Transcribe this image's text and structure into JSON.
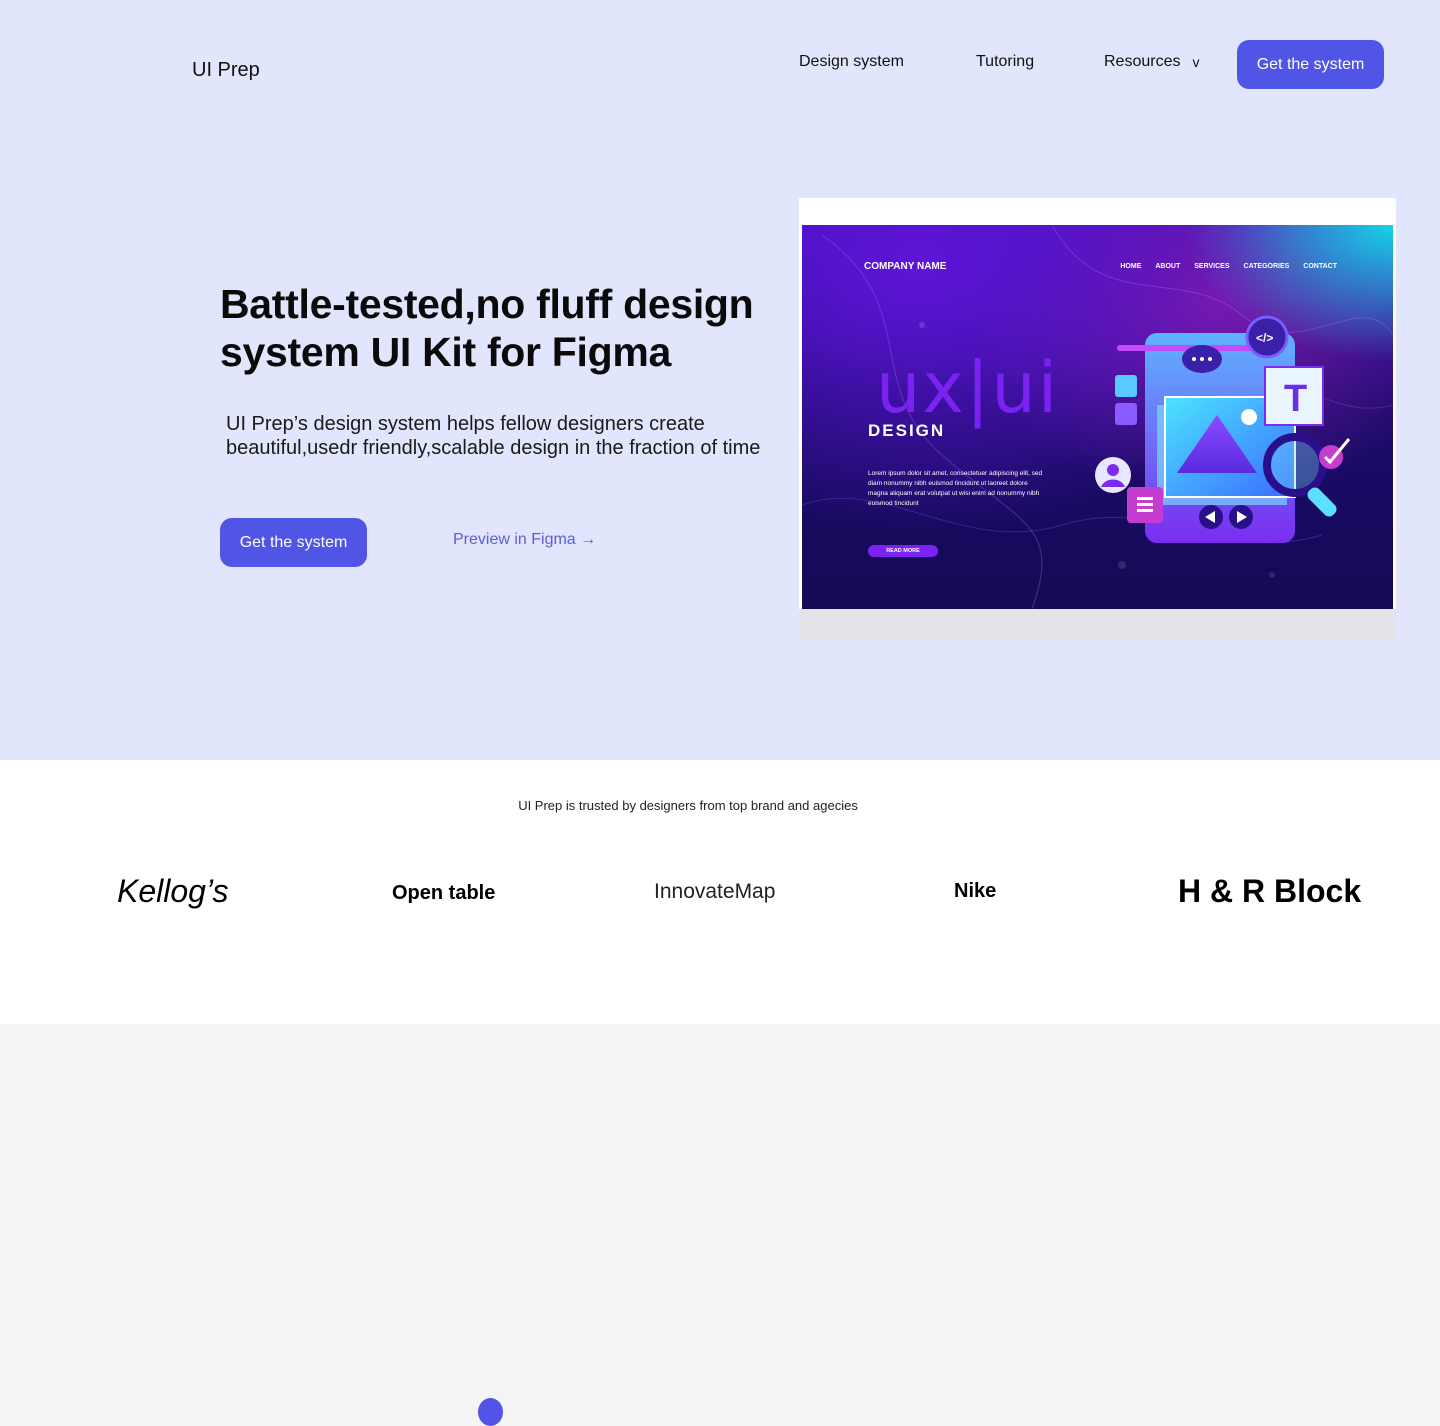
{
  "header": {
    "logo": "UI Prep",
    "nav": {
      "design_system": "Design system",
      "tutoring": "Tutoring",
      "resources": "Resources",
      "resources_chevron": "v"
    },
    "cta": "Get the system"
  },
  "hero": {
    "headline": "Battle-tested,no fluff design system UI Kit for Figma",
    "subtext": "UI  Prep’s design system helps fellow designers create beautiful,usedr friendly,scalable design in the fraction of time",
    "primary_cta": "Get the system",
    "secondary_cta": "Preview in Figma →"
  },
  "mockup": {
    "company": "COMPANY NAME",
    "nav": [
      "HOME",
      "ABOUT",
      "SERVICES",
      "CATEGORIES",
      "CONTACT"
    ],
    "big_text": "ux|ui",
    "design_label": "DESIGN",
    "body": "Lorem ipsum dolor sit amet, consectetuer adipiscing elit, sed diam nonummy nibh euismod tincidunt ut laoreet dolore magna aliquam erat volutpat ut wisi enim ad nonummy nibh euismod tincidunt",
    "read_more": "READ MORE",
    "tile_letter": "T",
    "code_glyph": "</>"
  },
  "brands": {
    "trusted_text": "UI Prep is trusted by designers from top brand and agecies",
    "logos": [
      "Kellog’s",
      "Open table",
      "InnovateMap",
      "Nike",
      "H & R Block"
    ]
  },
  "colors": {
    "hero_bg": "#e1e6fc",
    "accent": "#5055e6",
    "link": "#5b5fd6",
    "brands_bg": "#ffffff",
    "bottom_bg": "#f4f4f4"
  }
}
